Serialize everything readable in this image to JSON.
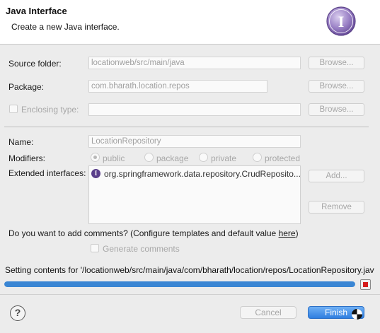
{
  "header": {
    "title": "Java Interface",
    "subtitle": "Create a new Java interface.",
    "icon": "interface-wizard-icon",
    "icon_letter": "I",
    "icon_color": "#8a6fb8"
  },
  "source_folder": {
    "label": "Source folder:",
    "value": "locationweb/src/main/java",
    "browse": "Browse..."
  },
  "package": {
    "label": "Package:",
    "value": "com.bharath.location.repos",
    "browse": "Browse..."
  },
  "enclosing_type": {
    "label": "Enclosing type:",
    "value": "",
    "checked": false,
    "browse": "Browse..."
  },
  "name": {
    "label": "Name:",
    "value": "LocationRepository"
  },
  "modifiers": {
    "label": "Modifiers:",
    "options": [
      "public",
      "package",
      "private",
      "protected"
    ],
    "selected": "public"
  },
  "extended_interfaces": {
    "label": "Extended interfaces:",
    "items": [
      "org.springframework.data.repository.CrudReposito..."
    ],
    "item_icon_letter": "I",
    "add": "Add...",
    "remove": "Remove"
  },
  "comments": {
    "question": "Do you want to add comments? (Configure templates and default value ",
    "link": "here",
    "question_end": ")",
    "generate_label": "Generate comments",
    "generate_checked": false
  },
  "status": {
    "text": "Setting contents for '/locationweb/src/main/java/com/bharath/location/repos/LocationRepository.jav",
    "progress": 1.0,
    "accent": "#3a86d4"
  },
  "footer": {
    "help_glyph": "?",
    "cancel": "Cancel",
    "finish": "Finish"
  }
}
